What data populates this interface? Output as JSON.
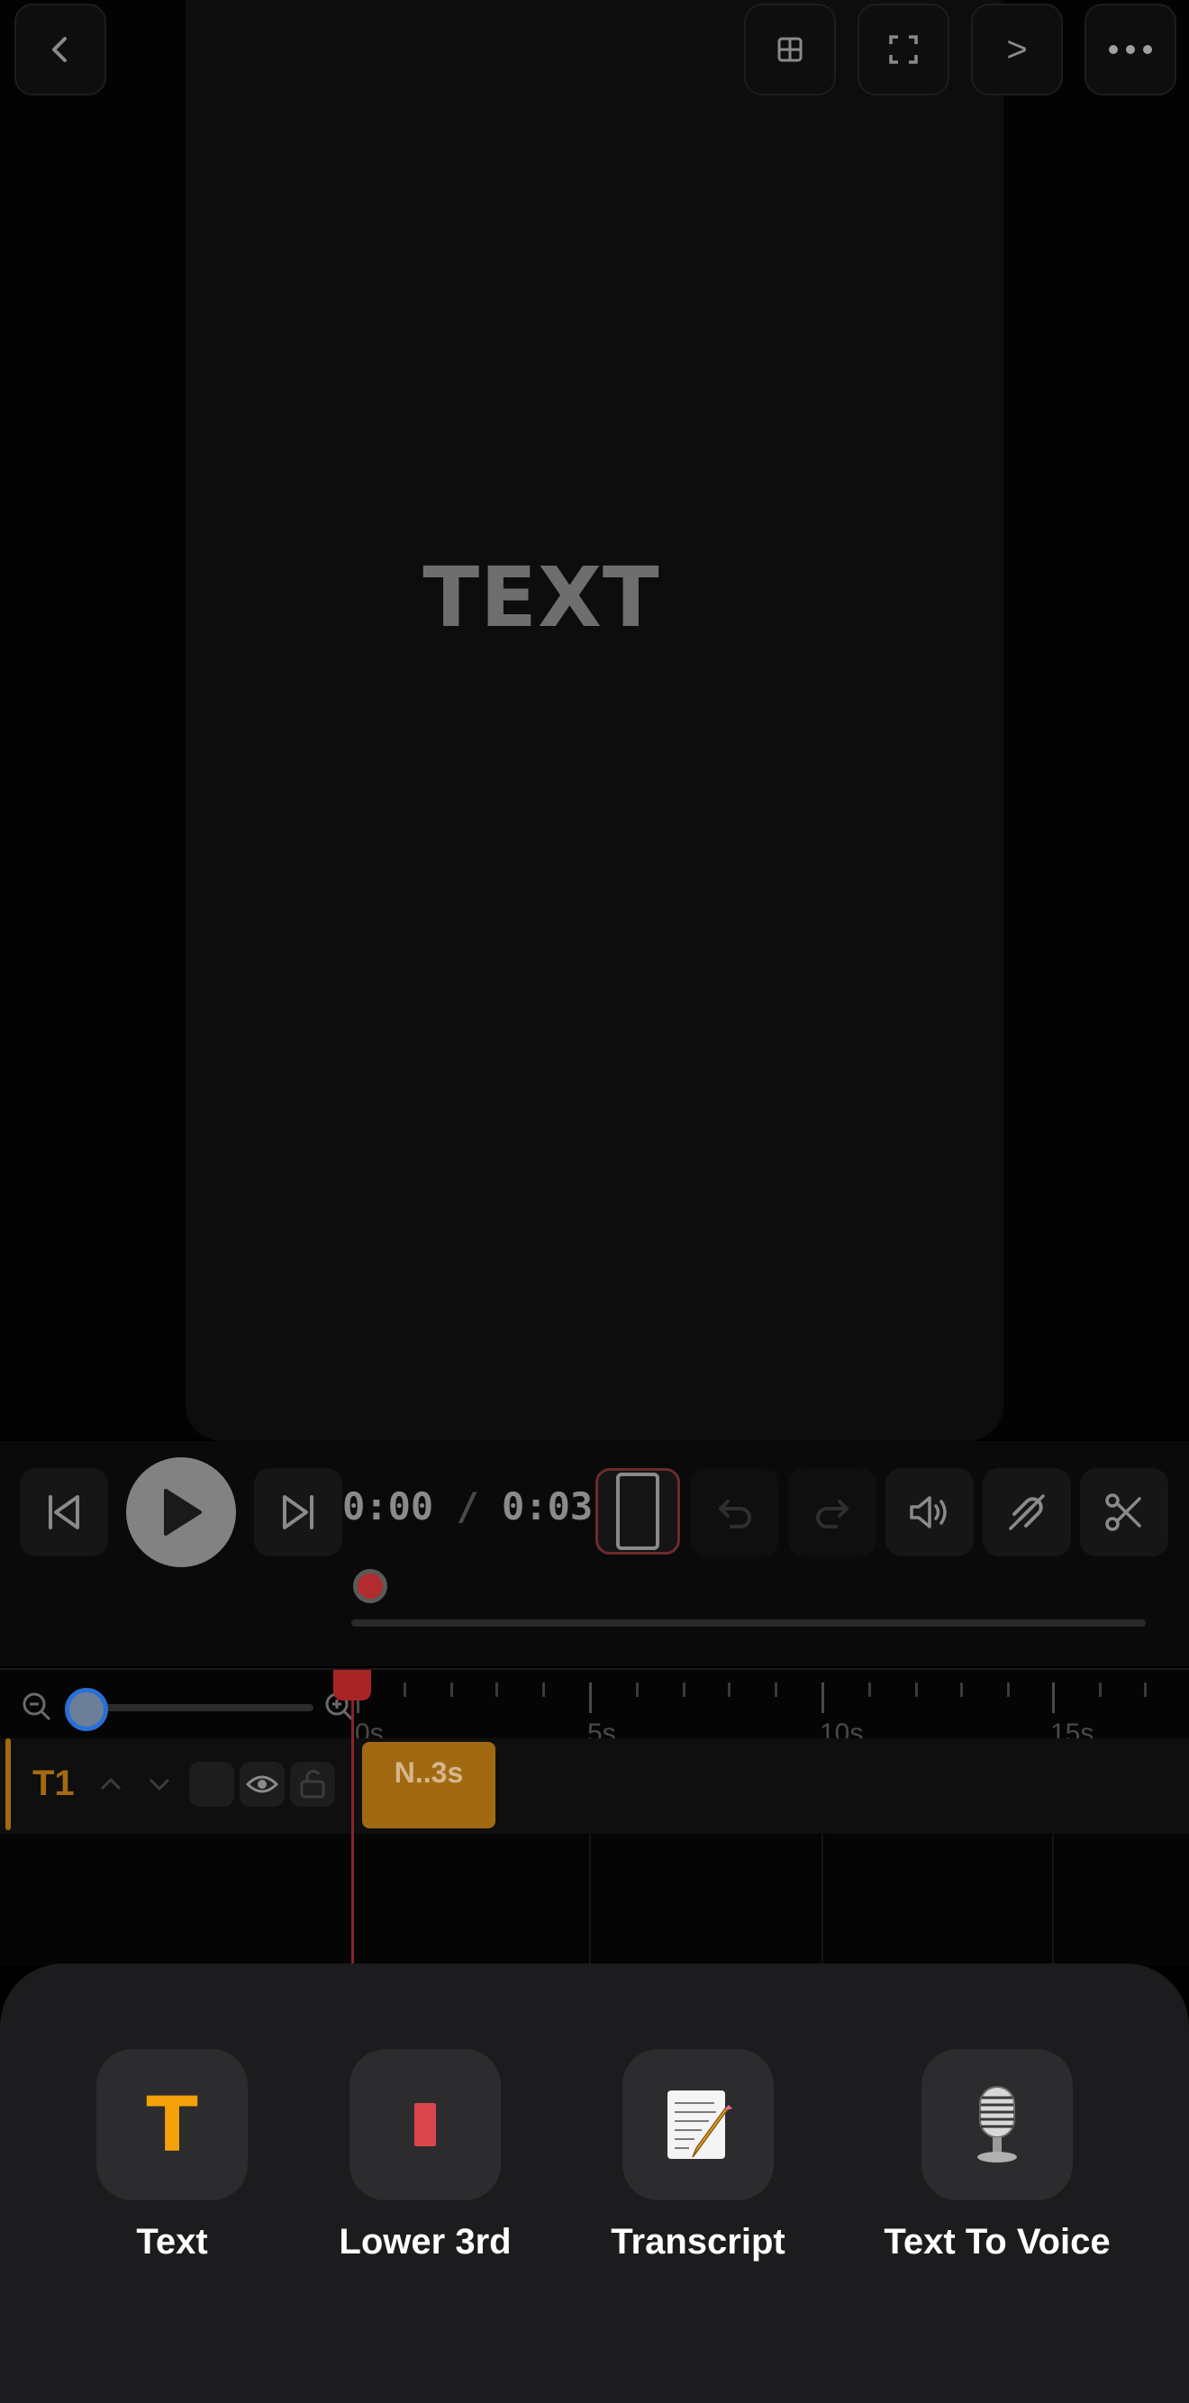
{
  "canvas": {
    "text": "TEXT"
  },
  "top_bar": {
    "back_icon": "chevron-left-icon",
    "layout_icon": "grid-icon",
    "fullscreen_icon": "fullscreen-icon",
    "export_label": ">",
    "more_icon": "ellipsis-icon"
  },
  "playback": {
    "current_time": "0:00",
    "separator": "/",
    "duration": "0:03"
  },
  "timeline": {
    "ticks": [
      "0s",
      "5s",
      "10s",
      "15s"
    ],
    "track": {
      "name": "T1",
      "clip_label": "N..3s",
      "clip_color": "#a16a12"
    }
  },
  "sheet": {
    "options": [
      {
        "label": "Text",
        "icon": "text-t-icon"
      },
      {
        "label": "Lower 3rd",
        "icon": "lower-third-icon"
      },
      {
        "label": "Transcript",
        "icon": "memo-icon"
      },
      {
        "label": "Text To Voice",
        "icon": "microphone-icon"
      }
    ]
  },
  "colors": {
    "accent": "#a46a10",
    "playhead": "#a82527",
    "text_icon": "#f5a10a"
  }
}
